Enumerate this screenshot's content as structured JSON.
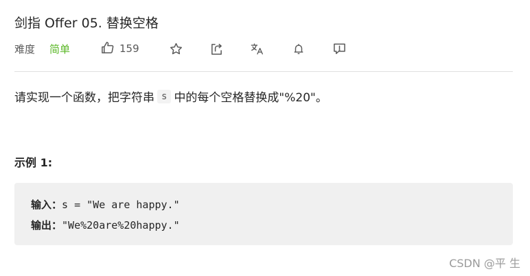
{
  "problem": {
    "title": "剑指 Offer 05. 替换空格",
    "difficulty_label": "难度",
    "difficulty_value": "简单",
    "likes": "159",
    "description_before": "请实现一个函数，把字符串",
    "description_code": "s",
    "description_after": "中的每个空格替换成\"%20\"。"
  },
  "example": {
    "title": "示例 1:",
    "input_label": "输入：",
    "input_value": "s = \"We are happy.\"",
    "output_label": "输出：",
    "output_value": "\"We%20are%20happy.\""
  },
  "watermark": "CSDN @平 生",
  "colors": {
    "difficulty_easy": "#5ab726",
    "code_background": "#f0f0f0",
    "separator": "#e0e0e0"
  },
  "icons": [
    "thumbs-up-icon",
    "star-icon",
    "share-icon",
    "translate-icon",
    "bell-icon",
    "feedback-icon"
  ]
}
